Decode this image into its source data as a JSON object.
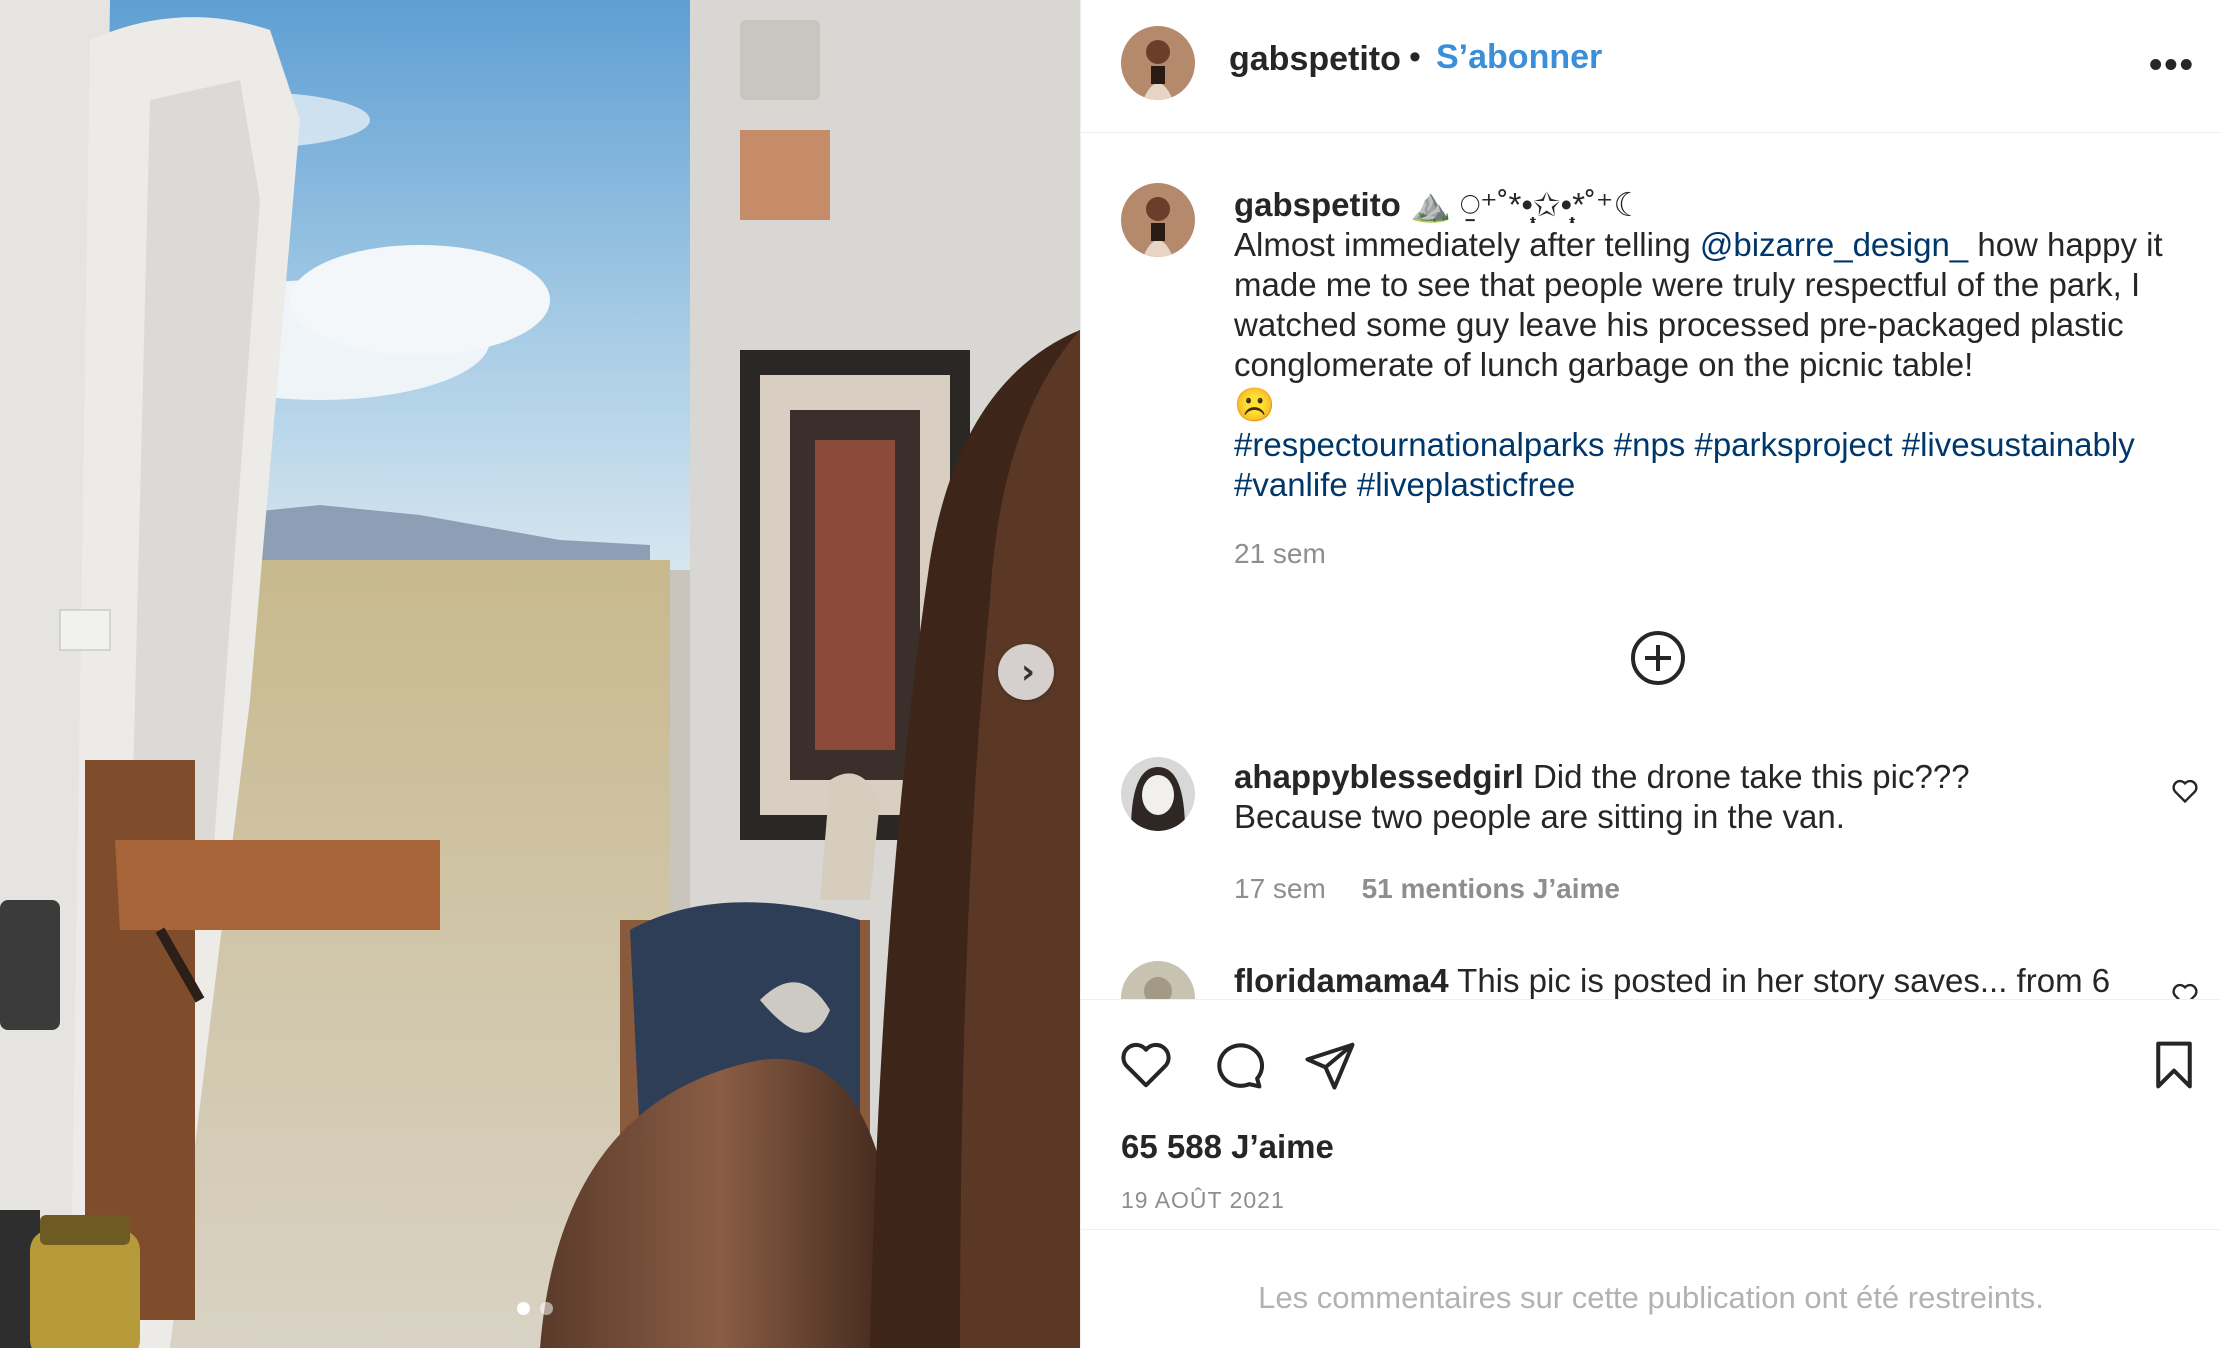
{
  "post": {
    "username": "gabspetito",
    "follow_label": "S’abonner",
    "separator": "•",
    "more_label": "•••",
    "next_label": "›"
  },
  "caption": {
    "username": "gabspetito",
    "emoji": "⛰️ ⍜⁺˚*•̩̩͙✩•̩̩͙*˚⁺☾",
    "text_before": "Almost immediately after telling ",
    "mention": "@bizarre_design_",
    "text_after": " how happy it made me to see that people were truly respectful of the park, I watched some guy leave his processed pre-packaged plastic conglomerate of lunch garbage on the picnic table!",
    "sad_emoji": "☹️",
    "hashtags": [
      "#respectournationalparks",
      "#nps",
      "#parksproject",
      "#livesustainably",
      "#vanlife",
      "#liveplasticfree"
    ],
    "time": "21 sem"
  },
  "comments": [
    {
      "username": "ahappyblessedgirl",
      "text": "Did the drone take this pic??? Because two people are sitting in the van.",
      "time": "17 sem",
      "likes": "51 mentions J’aime"
    },
    {
      "username": "floridamama4",
      "text": "This pic is posted in her story saves... from 6"
    }
  ],
  "footer": {
    "likes": "65 588 J’aime",
    "date": "19 AOÛT 2021",
    "restricted": "Les commentaires sur cette publication ont été restreints."
  },
  "carousel": {
    "slides": 2,
    "current": 1
  },
  "colors": {
    "accent": "#3b8ed8",
    "link": "#00376b",
    "muted": "#8e8e8e",
    "text": "#262626"
  },
  "icons": [
    "heart-icon",
    "comment-icon",
    "share-icon",
    "bookmark-icon",
    "plus-circle-icon",
    "chevron-right-icon",
    "more-icon"
  ]
}
